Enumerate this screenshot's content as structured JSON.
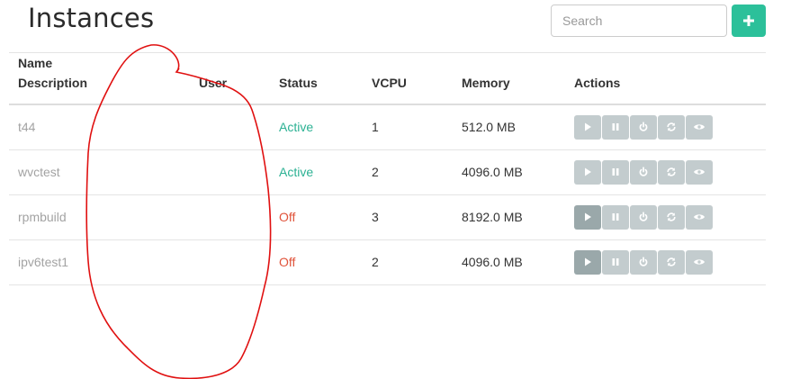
{
  "header": {
    "title": "Instances",
    "search_placeholder": "Search",
    "add_button_icon": "plus-icon"
  },
  "table": {
    "columns": {
      "name": "Name",
      "description": "Description",
      "user": "User",
      "status": "Status",
      "vcpu": "VCPU",
      "memory": "Memory",
      "actions": "Actions"
    },
    "rows": [
      {
        "name": "t44",
        "user": "",
        "status": "Active",
        "vcpu": "1",
        "memory": "512.0 MB",
        "running": true
      },
      {
        "name": "wvctest",
        "user": "",
        "status": "Active",
        "vcpu": "2",
        "memory": "4096.0 MB",
        "running": true
      },
      {
        "name": "rpmbuild",
        "user": "",
        "status": "Off",
        "vcpu": "3",
        "memory": "8192.0 MB",
        "running": false
      },
      {
        "name": "ipv6test1",
        "user": "",
        "status": "Off",
        "vcpu": "2",
        "memory": "4096.0 MB",
        "running": false
      }
    ],
    "action_icons": [
      "play-icon",
      "pause-icon",
      "power-icon",
      "refresh-icon",
      "eye-icon"
    ]
  },
  "colors": {
    "accent": "#2cc09a",
    "status_active": "#2bb193",
    "status_off": "#e0533a",
    "annotation": "#e01010"
  }
}
